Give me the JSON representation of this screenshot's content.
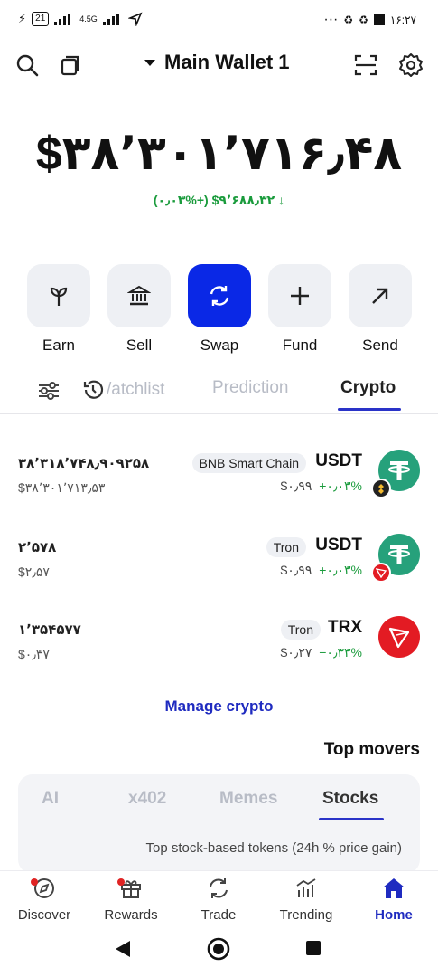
{
  "status_bar": {
    "battery": "21",
    "network": "4.5G",
    "time": "۱۶:۲۷",
    "dots": "···"
  },
  "header": {
    "title": "Main Wallet 1"
  },
  "balance": {
    "amount": "$۳۸٬۳۰۱٬۷۱۶٫۴۸",
    "change": "(۰٫۰۳%+) $۹٬۶۸۸٫۳۲ ↓"
  },
  "actions": [
    {
      "label": "Earn",
      "icon": "sprout-icon"
    },
    {
      "label": "Sell",
      "icon": "bank-icon"
    },
    {
      "label": "Swap",
      "icon": "swap-icon"
    },
    {
      "label": "Fund",
      "icon": "plus-icon"
    },
    {
      "label": "Send",
      "icon": "arrow-up-right-icon"
    }
  ],
  "tabs": {
    "watchlist": "/atchlist",
    "prediction": "Prediction",
    "crypto": "Crypto"
  },
  "assets": [
    {
      "qty": "۳۸٬۳۱۸٬۷۴۸٫۹۰۹۲۵۸",
      "fiat": "$۳۸٬۳۰۱٬۷۱۳٫۵۳",
      "chain": "BNB Smart Chain",
      "symbol": "USDT",
      "price": "$۰٫۹۹",
      "change": "+۰٫۰۳%"
    },
    {
      "qty": "۲٬۵۷۸",
      "fiat": "$۲٫۵۷",
      "chain": "Tron",
      "symbol": "USDT",
      "price": "$۰٫۹۹",
      "change": "+۰٫۰۳%"
    },
    {
      "qty": "۱٬۳۵۴۵۷۷",
      "fiat": "$۰٫۳۷",
      "chain": "Tron",
      "symbol": "TRX",
      "price": "$۰٫۲۷",
      "change": "−۰٫۳۳%"
    }
  ],
  "manage_label": "Manage crypto",
  "top_movers": {
    "title": "Top movers",
    "tabs": [
      "AI",
      "x402",
      "Memes",
      "Stocks"
    ],
    "caption": "Top stock-based tokens (24h % price gain)"
  },
  "bottom_nav": [
    {
      "label": "Discover"
    },
    {
      "label": "Rewards"
    },
    {
      "label": "Trade"
    },
    {
      "label": "Trending"
    },
    {
      "label": "Home"
    }
  ],
  "colors": {
    "accent": "#0a28e6",
    "positive": "#1a9b3c",
    "tether": "#26a17b",
    "tron": "#e31b23"
  }
}
